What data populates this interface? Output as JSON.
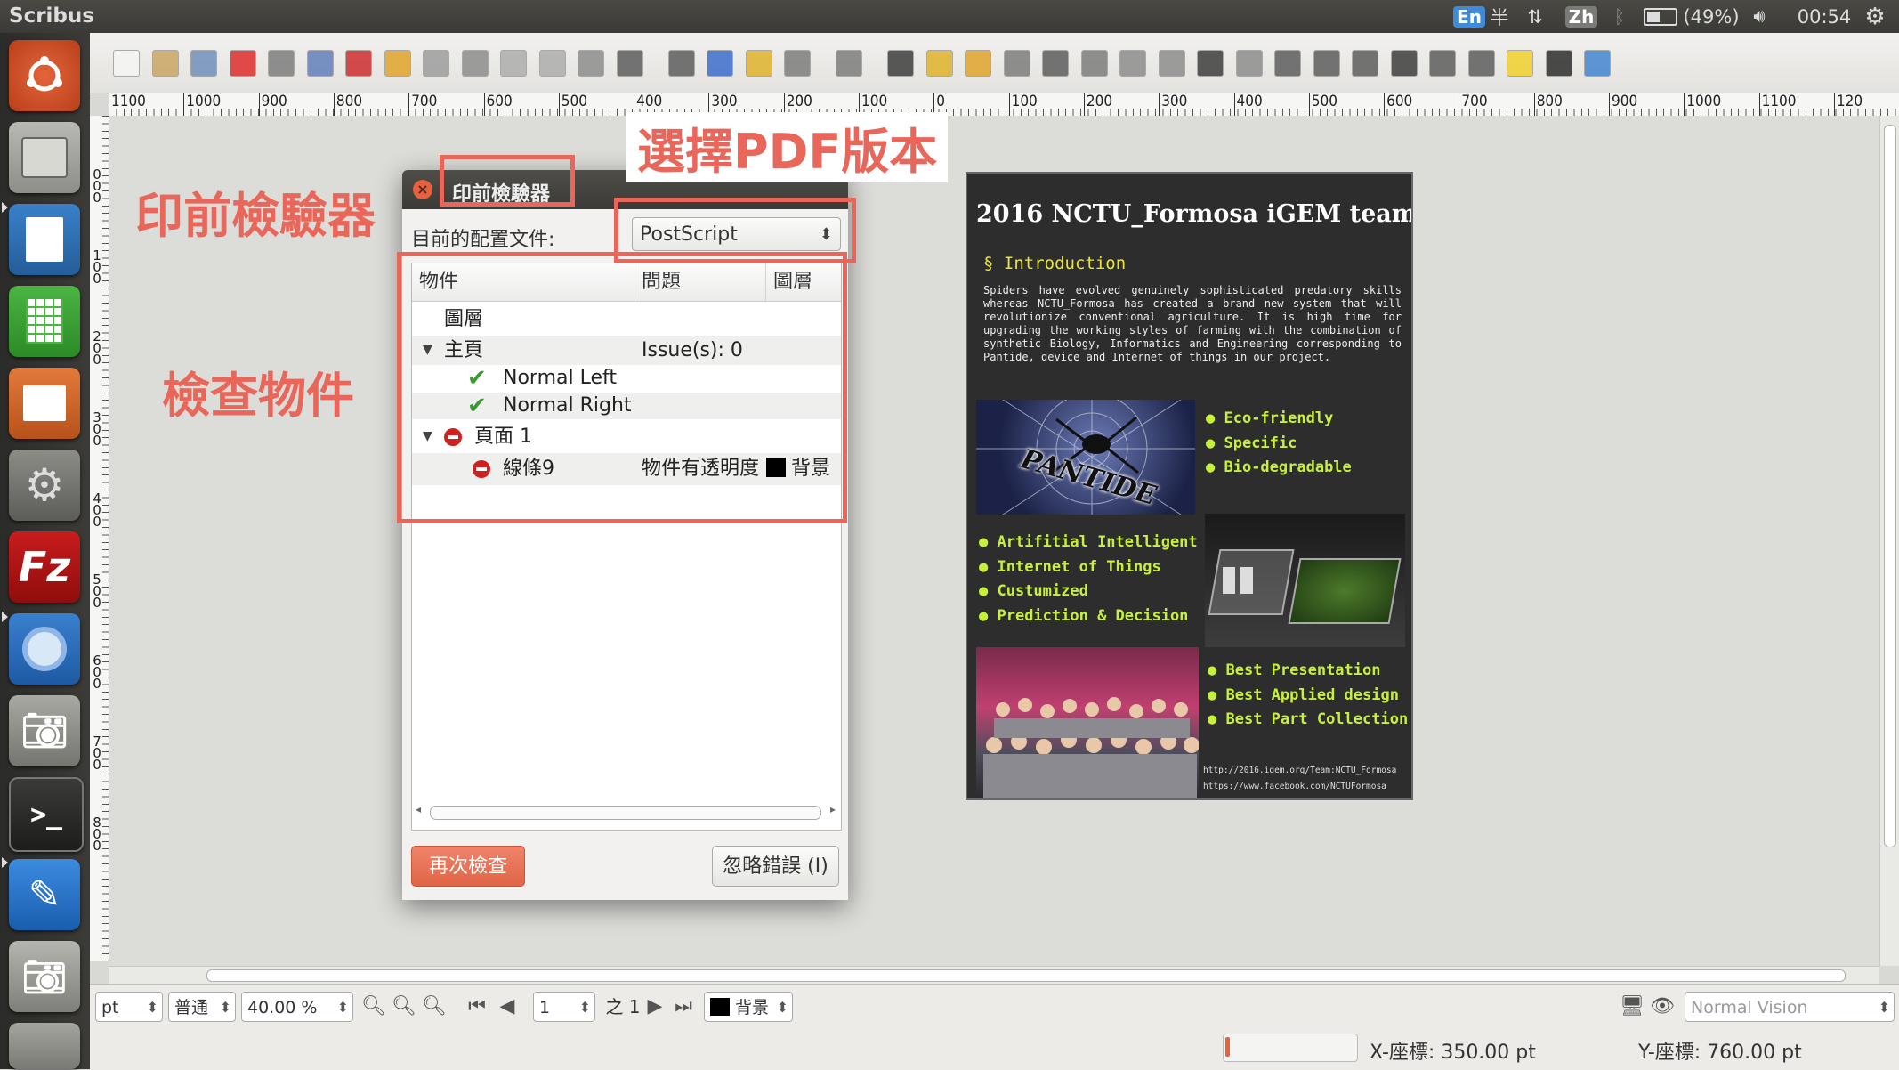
{
  "app": {
    "title": "Scribus"
  },
  "tray": {
    "input_en": "En",
    "half": "半",
    "input_zh": "Zh",
    "battery": "(49%)",
    "clock": "00:54"
  },
  "ruler": {
    "h_ticks": [
      "1100",
      "1000",
      "900",
      "800",
      "700",
      "600",
      "500",
      "400",
      "300",
      "200",
      "100",
      "0",
      "100",
      "200",
      "300",
      "400",
      "500",
      "600",
      "700",
      "800",
      "900",
      "1000",
      "1100",
      "120"
    ],
    "v_ticks": [
      "0",
      "1",
      "2",
      "3",
      "4",
      "5",
      "6",
      "7",
      "8"
    ]
  },
  "annotations": {
    "preflight": "印前檢驗器",
    "choose_pdf": "選擇PDF版本",
    "check_objects": "檢查物件"
  },
  "dialog": {
    "title": "印前檢驗器",
    "profile_label": "目前的配置文件:",
    "profile_value": "PostScript",
    "columns": [
      "物件",
      "問題",
      "圖層"
    ],
    "rows": {
      "layers": "圖層",
      "master": "主頁",
      "master_issues": "Issue(s): 0",
      "normal_left": "Normal Left",
      "normal_right": "Normal Right",
      "page1": "頁面 1",
      "line9": "線條9",
      "line9_issue": "物件有透明度",
      "line9_layer": "背景"
    },
    "recheck_button": "再次檢查",
    "ignore_button": "忽略錯誤 (I)"
  },
  "document": {
    "title": "2016 NCTU_Formosa iGEM team",
    "section": "§ Introduction",
    "body": "Spiders have evolved genuinely sophisticated predatory skills whereas NCTU_Formosa has created a brand new system that will revolutionize conventional agriculture. It is high time for upgrading the working styles of farming with the combination of synthetic Biology, Informatics and Engineering corresponding to Pantide, device and Internet of things in our project.",
    "list1": [
      "Eco-friendly",
      "Specific",
      "Bio-degradable"
    ],
    "list2": [
      "Artifitial Intelligent",
      "Internet of Things",
      "Custumized",
      "Prediction & Decision"
    ],
    "list3": [
      "Best Presentation",
      "Best Applied design",
      "Best Part Collection"
    ],
    "image1_text": "PANTIDE",
    "url1": "http://2016.igem.org/Team:NCTU_Formosa",
    "url2": "https://www.facebook.com/NCTUFormosa"
  },
  "status": {
    "unit": "pt",
    "mode": "普通",
    "zoom": "40.00 %",
    "page_number": "1",
    "page_total": "之 1",
    "layer": "背景",
    "vision": "Normal Vision",
    "x_coord": "X-座標: 350.00 pt",
    "y_coord": "Y-座標: 760.00 pt"
  },
  "colors": {
    "annotation": "#e8675a",
    "accent_orange": "#e16447",
    "page_bg": "#2d2d2d",
    "list_green": "#c7f03c",
    "section_yellow": "#e8e53a"
  }
}
